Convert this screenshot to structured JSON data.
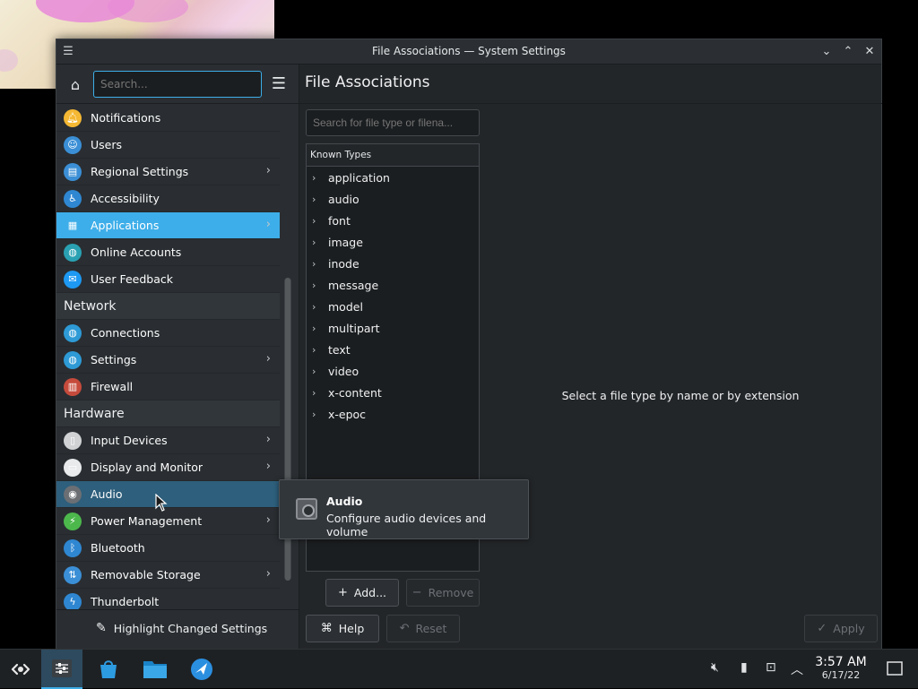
{
  "window": {
    "title": "File Associations — System Settings"
  },
  "sidebar": {
    "search_placeholder": "Search...",
    "items_top": [
      {
        "label": "Notifications",
        "icon": "bell-icon",
        "color": "#f5b833",
        "arrow": false
      },
      {
        "label": "Users",
        "icon": "users-icon",
        "color": "#3b8fd6",
        "arrow": false
      },
      {
        "label": "Regional Settings",
        "icon": "flag-icon",
        "color": "#3b8fd6",
        "arrow": true
      },
      {
        "label": "Accessibility",
        "icon": "accessibility-icon",
        "color": "#2f87d2",
        "arrow": false
      },
      {
        "label": "Applications",
        "icon": "apps-icon",
        "color": "#3daee9",
        "arrow": true,
        "selected": true
      },
      {
        "label": "Online Accounts",
        "icon": "globe-icon",
        "color": "#2aa1b3",
        "arrow": false
      },
      {
        "label": "User Feedback",
        "icon": "chat-icon",
        "color": "#1d99f3",
        "arrow": false
      }
    ],
    "section_network": "Network",
    "items_network": [
      {
        "label": "Connections",
        "icon": "globe-icon",
        "color": "#2e9ad6",
        "arrow": false
      },
      {
        "label": "Settings",
        "icon": "globe-icon",
        "color": "#2e9ad6",
        "arrow": true
      },
      {
        "label": "Firewall",
        "icon": "firewall-icon",
        "color": "#c64b3c",
        "arrow": false
      }
    ],
    "section_hardware": "Hardware",
    "items_hardware": [
      {
        "label": "Input Devices",
        "icon": "mouse-icon",
        "color": "#d0d2d4",
        "arrow": true
      },
      {
        "label": "Display and Monitor",
        "icon": "monitor-icon",
        "color": "#e8eaec",
        "arrow": true
      },
      {
        "label": "Audio",
        "icon": "speaker-icon",
        "color": "#6b6f73",
        "arrow": false,
        "hover": true
      },
      {
        "label": "Power Management",
        "icon": "power-icon",
        "color": "#4cb84c",
        "arrow": true
      },
      {
        "label": "Bluetooth",
        "icon": "bluetooth-icon",
        "color": "#2f87d2",
        "arrow": false
      },
      {
        "label": "Removable Storage",
        "icon": "usb-icon",
        "color": "#3b8fd6",
        "arrow": true
      },
      {
        "label": "Thunderbolt",
        "icon": "thunderbolt-icon",
        "color": "#2f87d2",
        "arrow": false
      }
    ],
    "footer_button": "Highlight Changed Settings"
  },
  "main": {
    "title": "File Associations",
    "search_placeholder": "Search for file type or filena...",
    "tree_header": "Known Types",
    "types": [
      "application",
      "audio",
      "font",
      "image",
      "inode",
      "message",
      "model",
      "multipart",
      "text",
      "video",
      "x-content",
      "x-epoc"
    ],
    "add_label": "Add...",
    "remove_label": "Remove",
    "help_label": "Help",
    "reset_label": "Reset",
    "apply_label": "Apply",
    "placeholder": "Select a file type by name or by extension"
  },
  "tooltip": {
    "title": "Audio",
    "description": "Configure audio devices and volume"
  },
  "taskbar": {
    "time": "3:57 AM",
    "date": "6/17/22"
  }
}
